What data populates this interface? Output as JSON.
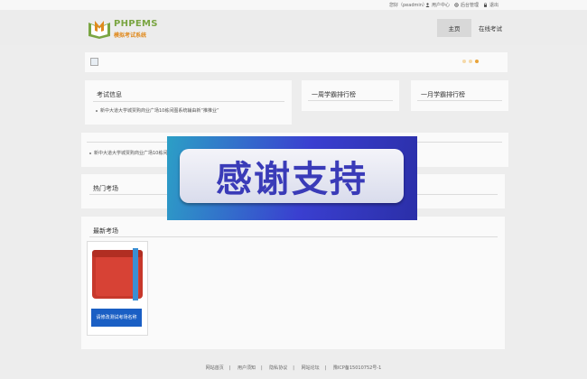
{
  "topbar": {
    "greeting": "您好（peadmin）",
    "user_center": "用户中心",
    "admin": "后台管理",
    "logout": "退出"
  },
  "header": {
    "logo_title": "PHPEMS",
    "logo_subtitle": "模拟考试系统",
    "nav": [
      {
        "label": "主页"
      },
      {
        "label": "在线考试"
      }
    ]
  },
  "exam_info": {
    "title": "考试信息",
    "items": [
      "新中大道大学城贾购商业广场10栋间图系统辅由新“推推业”"
    ]
  },
  "weekly_rank": {
    "title": "一周学霸排行榜"
  },
  "monthly_rank": {
    "title": "一月学霸排行榜"
  },
  "notice": {
    "items": [
      "新中大道大学城贾购商业广场10栋间图系统"
    ]
  },
  "hot_exams": {
    "title": "热门考场"
  },
  "new_exams": {
    "title": "最新考场",
    "cards": [
      {
        "label": "请修改测试考场名称"
      }
    ]
  },
  "overlay": {
    "text": "感谢支持"
  },
  "footer": {
    "links": [
      "网站首页",
      "用户须知",
      "隐私协议",
      "网站论坛",
      "豫ICP备15010752号-1"
    ]
  },
  "colors": {
    "brand_green": "#7aa542",
    "brand_orange": "#e08a1e",
    "button_blue": "#1a5fc4",
    "overlay_bg": "#3a3fd0"
  }
}
